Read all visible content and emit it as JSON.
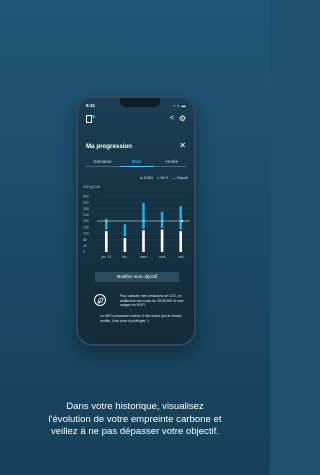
{
  "status_bar": {
    "time": "9:41",
    "icons": "▪ ≈ ▬"
  },
  "top_bar": {
    "share_icon": "share-icon",
    "settings_icon": "gear-icon"
  },
  "screen": {
    "title": "Ma progression",
    "close": "✕"
  },
  "tabs": [
    {
      "label": "Semaine",
      "active": false
    },
    {
      "label": "Mois",
      "active": true
    },
    {
      "label": "Année",
      "active": false
    }
  ],
  "legend": {
    "series_4g": "4G/5G",
    "series_wifi": "Wi-Fi",
    "objective": "Objectif"
  },
  "chart_data": {
    "type": "bar",
    "categories": [
      "jan. 21",
      "fév.",
      "mars",
      "avril",
      "mai"
    ],
    "ylabel": "400 gCO2e",
    "yticks": [
      "360",
      "320",
      "280",
      "240",
      "200",
      "160",
      "120",
      "80",
      "40",
      "0"
    ],
    "ylim": [
      0,
      400
    ],
    "series": [
      {
        "name": "4G/5G",
        "values": [
          135,
          90,
          140,
          145,
          135
        ],
        "color": "#ffffff"
      },
      {
        "name": "Wi-Fi",
        "values": [
          80,
          90,
          175,
          115,
          160
        ],
        "color": "#29a8e0"
      }
    ],
    "objective": 200,
    "grid": true
  },
  "buttons": {
    "modify": "Modifier mon objectif"
  },
  "info": {
    "text1": "Pour calculer mes émissions de CO2, on additionne ma conso de 3G/4G/5G et mes usages en Wi-Fi.",
    "text2": "Le WiFi consomme environ 4 fois moins que le réseau mobile. Il est donc à privilégier ;)"
  },
  "caption": {
    "line1": "Dans votre historique, visualisez",
    "line2": "l'évolution de votre empreinte carbone et",
    "line3": "veillez à ne pas dépasser votre objectif."
  },
  "colors": {
    "accent": "#4fc3ef",
    "bar_wifi": "#29a8e0",
    "bar_mobile": "#ffffff",
    "background": "#1d4f6e"
  }
}
